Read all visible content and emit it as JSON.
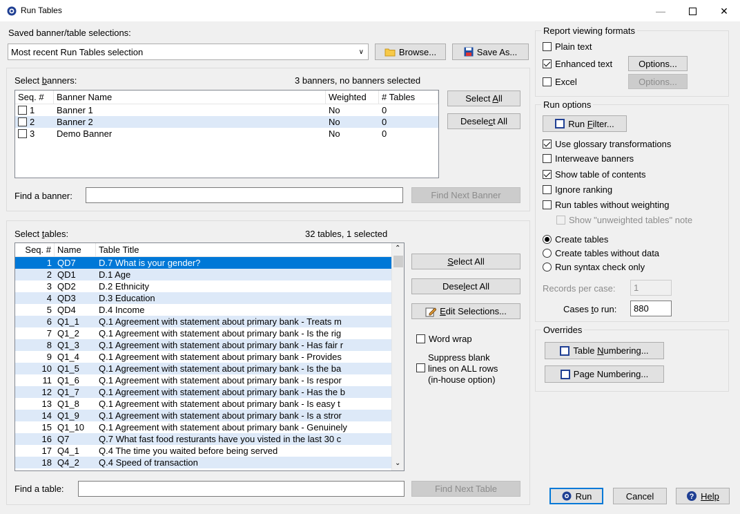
{
  "window": {
    "title": "Run Tables"
  },
  "saved": {
    "label": "Saved banner/table selections:",
    "selected": "Most recent Run Tables selection",
    "browse_label": "Browse...",
    "save_as_label": "Save As..."
  },
  "banners": {
    "label": "Select banners:",
    "status": "3 banners, no banners selected",
    "columns": [
      "Seq. #",
      "Banner Name",
      "Weighted",
      "# Tables"
    ],
    "rows": [
      {
        "seq": "1",
        "name": "Banner 1",
        "weighted": "No",
        "tables": "0"
      },
      {
        "seq": "2",
        "name": "Banner 2",
        "weighted": "No",
        "tables": "0"
      },
      {
        "seq": "3",
        "name": "Demo Banner",
        "weighted": "No",
        "tables": "0"
      }
    ],
    "select_all": "Select All",
    "deselect_all": "Deselect All",
    "find_label": "Find a banner:",
    "find_value": "",
    "find_next": "Find Next Banner"
  },
  "tables": {
    "label": "Select tables:",
    "status": "32 tables, 1 selected",
    "columns": [
      "Seq. #",
      "Name",
      "Table Title"
    ],
    "rows": [
      {
        "seq": "1",
        "name": "QD7",
        "title": "D.7  What is your gender?"
      },
      {
        "seq": "2",
        "name": "QD1",
        "title": "D.1  Age"
      },
      {
        "seq": "3",
        "name": "QD2",
        "title": "D.2  Ethnicity"
      },
      {
        "seq": "4",
        "name": "QD3",
        "title": "D.3  Education"
      },
      {
        "seq": "5",
        "name": "QD4",
        "title": "D.4  Income"
      },
      {
        "seq": "6",
        "name": "Q1_1",
        "title": "Q.1  Agreement with statement about primary bank - Treats m"
      },
      {
        "seq": "7",
        "name": "Q1_2",
        "title": "Q.1  Agreement with statement about primary bank - Is the rig"
      },
      {
        "seq": "8",
        "name": "Q1_3",
        "title": "Q.1  Agreement with statement about primary bank - Has fair r"
      },
      {
        "seq": "9",
        "name": "Q1_4",
        "title": "Q.1  Agreement with statement about primary bank - Provides"
      },
      {
        "seq": "10",
        "name": "Q1_5",
        "title": "Q.1  Agreement with statement about primary bank - Is the ba"
      },
      {
        "seq": "11",
        "name": "Q1_6",
        "title": "Q.1  Agreement with statement about primary bank - Is respor"
      },
      {
        "seq": "12",
        "name": "Q1_7",
        "title": "Q.1  Agreement with statement about primary bank - Has the b"
      },
      {
        "seq": "13",
        "name": "Q1_8",
        "title": "Q.1  Agreement with statement about primary bank - Is easy t"
      },
      {
        "seq": "14",
        "name": "Q1_9",
        "title": "Q.1  Agreement with statement about primary bank - Is a stror"
      },
      {
        "seq": "15",
        "name": "Q1_10",
        "title": "Q.1  Agreement with statement about primary bank - Genuinely"
      },
      {
        "seq": "16",
        "name": "Q7",
        "title": "Q.7  What fast food resturants have you visted in the last 30 c"
      },
      {
        "seq": "17",
        "name": "Q4_1",
        "title": "Q.4  The time you waited before being served"
      },
      {
        "seq": "18",
        "name": "Q4_2",
        "title": "Q.4  Speed of transaction"
      }
    ],
    "select_all": "Select All",
    "deselect_all": "Deselect All",
    "edit_selections": "Edit Selections...",
    "word_wrap": "Word wrap",
    "suppress_line1": "Suppress blank",
    "suppress_line2": "lines on ALL rows",
    "suppress_line3": "(in-house option)",
    "find_label": "Find a table:",
    "find_value": "",
    "find_next": "Find Next Table"
  },
  "report_formats": {
    "legend": "Report viewing formats",
    "plain_text": "Plain text",
    "enhanced_text": "Enhanced text",
    "excel": "Excel",
    "options_label": "Options...",
    "options_label_disabled": "Options..."
  },
  "run_options": {
    "legend": "Run options",
    "run_filter": "Run Filter...",
    "use_glossary": "Use glossary transformations",
    "interweave": "Interweave banners",
    "show_toc": "Show table of contents",
    "ignore_ranking": "Ignore ranking",
    "without_weighting": "Run tables without weighting",
    "unweighted_note": "Show \"unweighted tables\" note",
    "create_tables": "Create tables",
    "create_without_data": "Create tables without data",
    "syntax_check": "Run syntax check only",
    "records_label": "Records per case:",
    "records_value": "1",
    "cases_label": "Cases to run:",
    "cases_value": "880"
  },
  "overrides": {
    "legend": "Overrides",
    "table_numbering": "Table Numbering...",
    "page_numbering": "Page Numbering..."
  },
  "footer": {
    "run": "Run",
    "cancel": "Cancel",
    "help": "Help"
  }
}
